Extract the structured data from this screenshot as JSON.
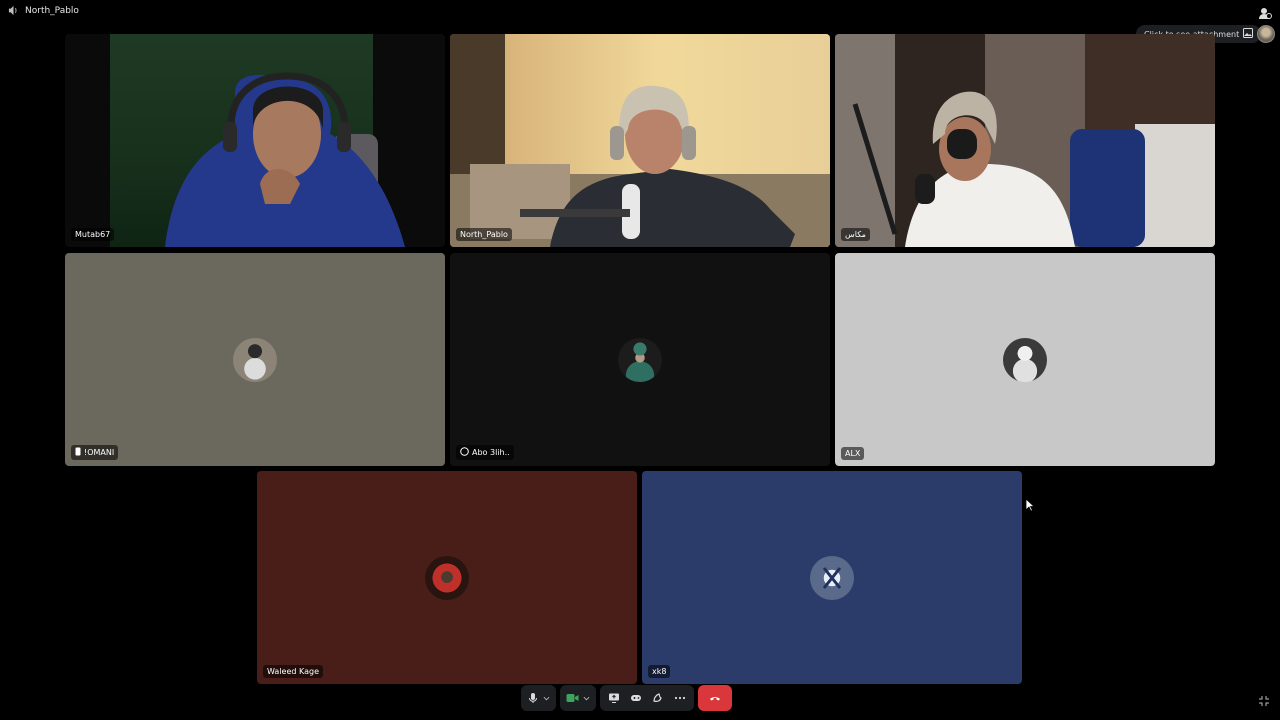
{
  "channel": {
    "name": "North_Pablo",
    "icon": "speaker-icon"
  },
  "attachment": {
    "label": "Click to see attachment"
  },
  "colors": {
    "speaking": "#3ba55d",
    "end_call": "#da373c",
    "control_bg": "#1e1f22"
  },
  "tiles": [
    {
      "name": "Mutab67"
    },
    {
      "name": "North_Pablo"
    },
    {
      "name": "مكاس"
    },
    {
      "name": "!OMANI"
    },
    {
      "name": "Abo 3lih.."
    },
    {
      "name": "ALX"
    },
    {
      "name": "Waleed Kage"
    },
    {
      "name": "xk8"
    }
  ],
  "controls": [
    {
      "name": "microphone",
      "icon": "microphone-icon"
    },
    {
      "name": "camera",
      "icon": "camera-icon"
    },
    {
      "name": "screen-share",
      "icon": "screen-share-icon"
    },
    {
      "name": "activities",
      "icon": "activities-icon"
    },
    {
      "name": "soundboard",
      "icon": "soundboard-icon"
    },
    {
      "name": "more",
      "icon": "more-icon"
    },
    {
      "name": "disconnect",
      "icon": "hang-up-icon"
    }
  ]
}
